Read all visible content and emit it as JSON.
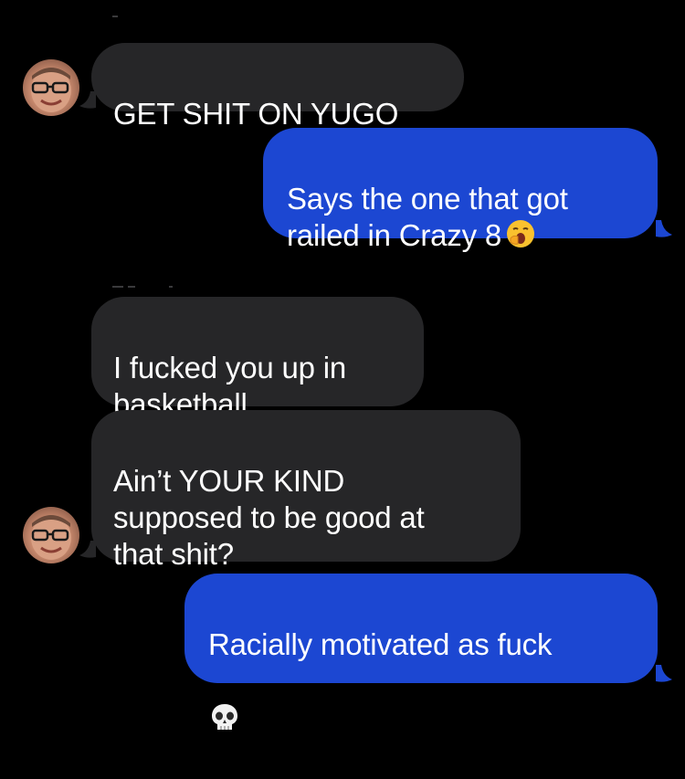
{
  "messages": [
    {
      "id": "m1",
      "direction": "received",
      "text": "GET SHIT ON YUGO"
    },
    {
      "id": "m2",
      "direction": "sent",
      "text": "Says the one that got\nrailed in Crazy 8",
      "emoji": "yawning-face"
    },
    {
      "id": "m3",
      "direction": "received",
      "text": "I fucked you up in\nbasketball"
    },
    {
      "id": "m4",
      "direction": "received",
      "text": "Ain’t YOUR KIND\nsupposed to be good at\nthat shit?"
    },
    {
      "id": "m5",
      "direction": "sent",
      "text": "Racially motivated as fuck",
      "emoji": "skull"
    }
  ],
  "colors": {
    "background": "#000000",
    "received_bubble": "#262628",
    "sent_bubble": "#1c47d2",
    "text": "#ffffff"
  },
  "icons": {
    "avatar": "contact-avatar",
    "emoji_m2": "yawning-face-emoji",
    "emoji_m5": "skull-emoji"
  }
}
